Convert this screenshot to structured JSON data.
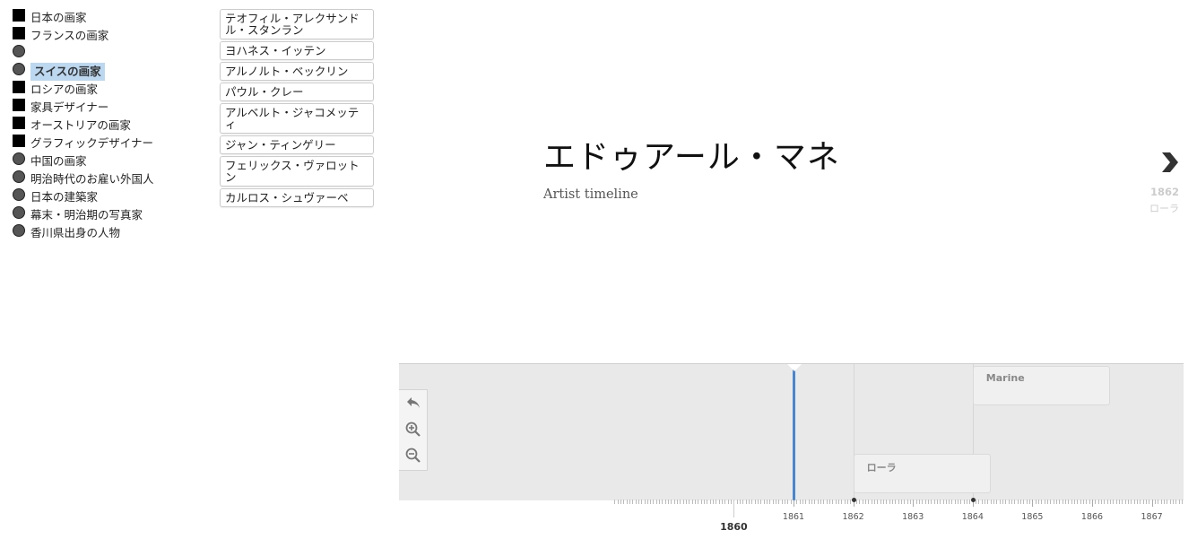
{
  "categories": [
    {
      "label": "日本の画家",
      "marker": "square",
      "selected": false
    },
    {
      "label": "フランスの画家",
      "marker": "square",
      "selected": false
    },
    {
      "label": "",
      "marker": "circle",
      "selected": false
    },
    {
      "label": "スイスの画家",
      "marker": "circle",
      "selected": true
    },
    {
      "label": "ロシアの画家",
      "marker": "square",
      "selected": false
    },
    {
      "label": "家具デザイナー",
      "marker": "square",
      "selected": false
    },
    {
      "label": "オーストリアの画家",
      "marker": "square",
      "selected": false
    },
    {
      "label": "グラフィックデザイナー",
      "marker": "square",
      "selected": false
    },
    {
      "label": "中国の画家",
      "marker": "circle",
      "selected": false
    },
    {
      "label": "明治時代のお雇い外国人",
      "marker": "circle",
      "selected": false
    },
    {
      "label": "日本の建築家",
      "marker": "circle",
      "selected": false
    },
    {
      "label": "幕末・明治期の写真家",
      "marker": "circle",
      "selected": false
    },
    {
      "label": "香川県出身の人物",
      "marker": "circle",
      "selected": false
    }
  ],
  "artists": [
    "テオフィル・アレクサンドル・スタンラン",
    "ヨハネス・イッテン",
    "アルノルト・ベックリン",
    "パウル・クレー",
    "アルベルト・ジャコメッティ",
    "ジャン・ティンゲリー",
    "フェリックス・ヴァロットン",
    "カルロス・シュヴァーベ"
  ],
  "slide": {
    "title": "エドゥアール・マネ",
    "subtitle": "Artist timeline"
  },
  "next": {
    "icon": "chevron-right-icon",
    "year": "1862",
    "title": "ローラ"
  },
  "timeline": {
    "controls": [
      "back-icon",
      "zoom-in-icon",
      "zoom-out-icon"
    ],
    "eras": [
      {
        "title": "Marine",
        "start_year": 1864.0,
        "end_year": 1866.3
      },
      {
        "title": "ローラ",
        "start_year": 1862.0,
        "end_year": 1864.3
      }
    ],
    "current_year": 1861.0,
    "event_years": [
      1862.0,
      1864.0
    ],
    "axis": {
      "start": 1858.0,
      "end": 1867.5,
      "labels": [
        "1861",
        "1862",
        "1863",
        "1864",
        "1865",
        "1866",
        "1867"
      ],
      "big_label": "1860"
    }
  },
  "colors": {
    "accent": "#4a86cf",
    "selected_bg": "#bcd8f0"
  }
}
